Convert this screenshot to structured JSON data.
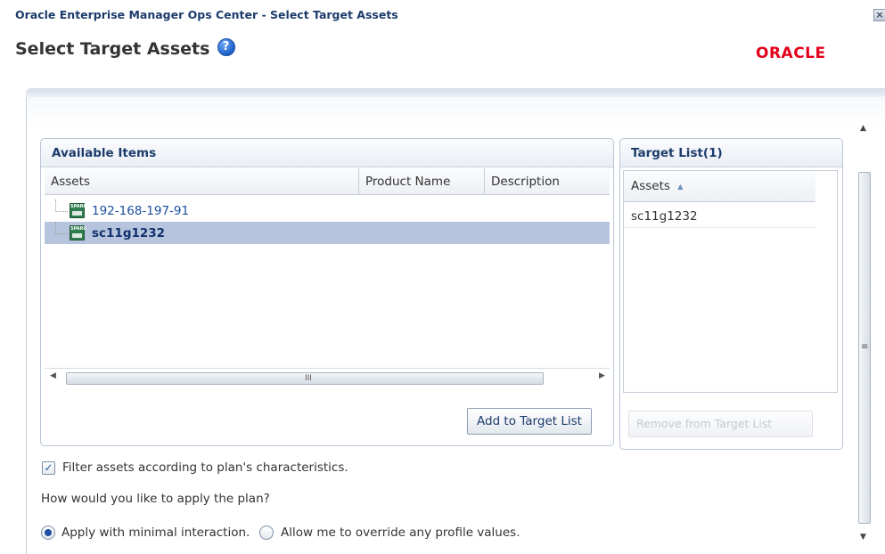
{
  "window": {
    "title": "Oracle Enterprise Manager Ops Center - Select Target Assets",
    "close_glyph": "×"
  },
  "header": {
    "title": "Select Target Assets",
    "help_glyph": "?",
    "logo": "ORACLE"
  },
  "available_items": {
    "title": "Available Items",
    "columns": [
      "Assets",
      "Product Name",
      "Description"
    ],
    "rows": [
      {
        "asset": "192-168-197-91",
        "product_name": "",
        "description": "",
        "selected": false
      },
      {
        "asset": "sc11g1232",
        "product_name": "",
        "description": "",
        "selected": true
      }
    ],
    "add_button": "Add to Target List",
    "scroll_grip": "III"
  },
  "target_list": {
    "title": "Target List(1)",
    "column": "Assets",
    "sort_indicator": "▲",
    "rows": [
      "sc11g1232"
    ],
    "remove_button": "Remove from Target List"
  },
  "options": {
    "filter_label": "Filter assets according to plan's characteristics.",
    "filter_checked": true,
    "question": "How would you like to apply the plan?",
    "radio_minimal": "Apply with minimal interaction.",
    "radio_override": "Allow me to override any profile values.",
    "selected_option": "minimal"
  },
  "icons": {
    "asset_icon": "sparc-server-icon",
    "asset_icon_text": "SPARC"
  },
  "colors": {
    "title_blue": "#1c3b6b",
    "link_blue": "#1c4fa0",
    "oracle_red": "#e2001a",
    "selection": "#b6c5dd"
  }
}
